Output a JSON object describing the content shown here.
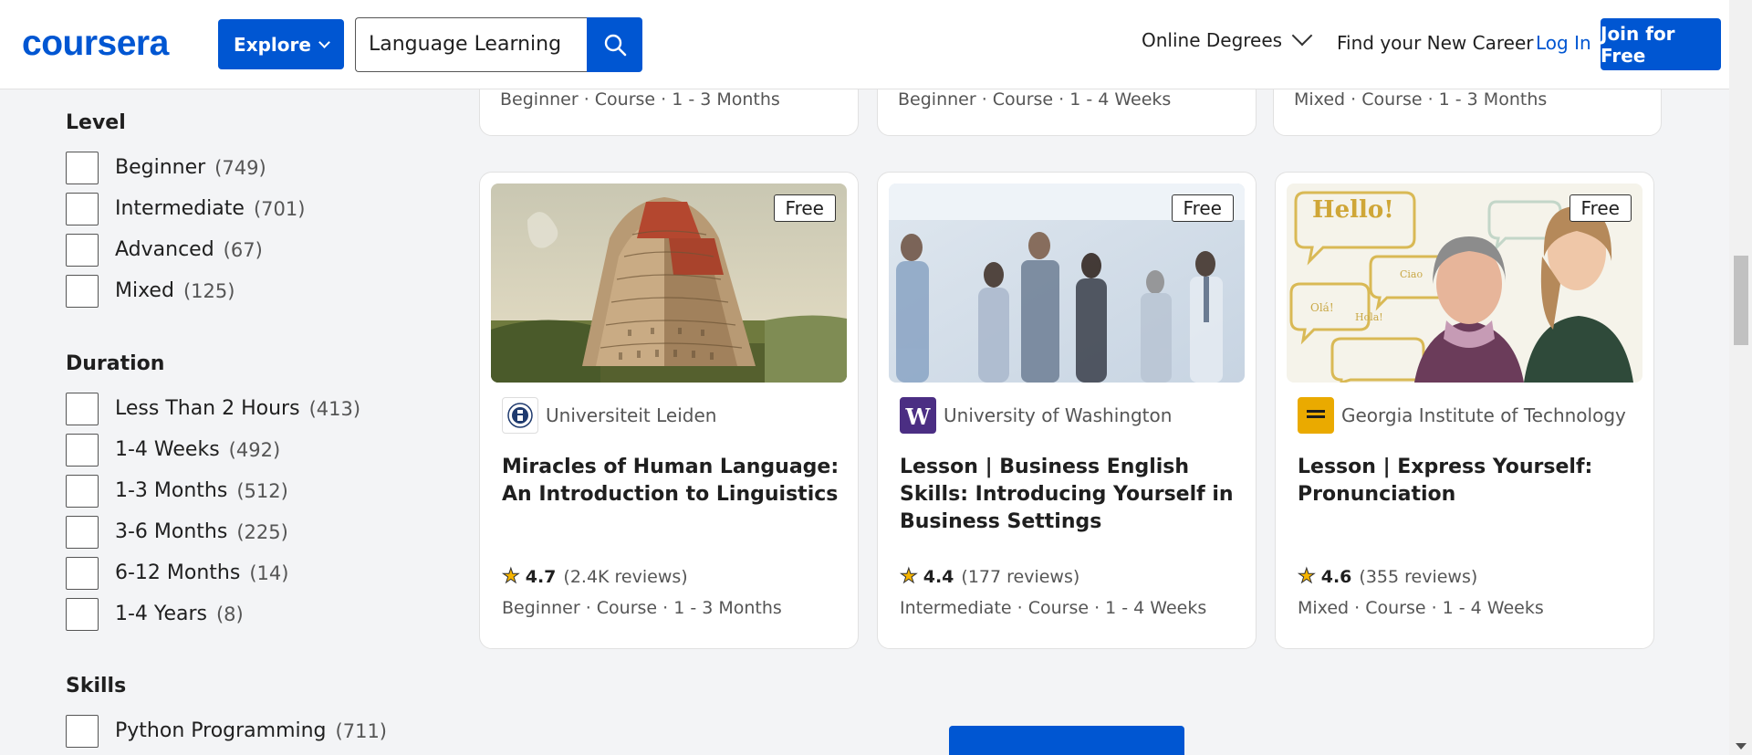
{
  "header": {
    "logo": "coursera",
    "explore_label": "Explore",
    "search_value": "Language Learning",
    "nav_online_degrees": "Online Degrees",
    "nav_find_career": "Find your New Career",
    "login_label": "Log In",
    "join_label": "Join for Free"
  },
  "filters": {
    "level": {
      "title": "Level",
      "items": [
        {
          "label": "Beginner",
          "count": "(749)"
        },
        {
          "label": "Intermediate",
          "count": "(701)"
        },
        {
          "label": "Advanced",
          "count": "(67)"
        },
        {
          "label": "Mixed",
          "count": "(125)"
        }
      ]
    },
    "duration": {
      "title": "Duration",
      "items": [
        {
          "label": "Less Than 2 Hours",
          "count": "(413)"
        },
        {
          "label": "1-4 Weeks",
          "count": "(492)"
        },
        {
          "label": "1-3 Months",
          "count": "(512)"
        },
        {
          "label": "3-6 Months",
          "count": "(225)"
        },
        {
          "label": "6-12 Months",
          "count": "(14)"
        },
        {
          "label": "1-4 Years",
          "count": "(8)"
        }
      ]
    },
    "skills": {
      "title": "Skills",
      "items": [
        {
          "label": "Python Programming",
          "count": "(711)"
        }
      ]
    }
  },
  "top_cards": [
    {
      "meta": "Beginner · Course · 1 - 3 Months"
    },
    {
      "meta": "Beginner · Course · 1 - 4 Weeks"
    },
    {
      "meta": "Mixed · Course · 1 - 3 Months"
    }
  ],
  "cards": [
    {
      "badge": "Free",
      "partner": "Universiteit Leiden",
      "partner_icon": "leiden-seal-icon",
      "title": "Miracles of Human Language: An Introduction to Linguistics",
      "rating": "4.7",
      "reviews": "(2.4K reviews)",
      "meta": "Beginner · Course · 1 - 3 Months"
    },
    {
      "badge": "Free",
      "partner": "University of Washington",
      "partner_icon": "uw-logo-icon",
      "title": "Lesson | Business English Skills: Introducing Yourself in Business Settings",
      "rating": "4.4",
      "reviews": "(177 reviews)",
      "meta": "Intermediate · Course · 1 - 4 Weeks"
    },
    {
      "badge": "Free",
      "partner": "Georgia Institute of Technology",
      "partner_icon": "georgia-tech-logo-icon",
      "title": "Lesson | Express Yourself: Pronunciation",
      "rating": "4.6",
      "reviews": "(355 reviews)",
      "meta": "Mixed · Course · 1 - 4 Weeks"
    }
  ],
  "image_text": {
    "hello": "Hello!",
    "ciao": "Ciao",
    "ola": "Olá!",
    "hola": "Hola!"
  },
  "colors": {
    "brand": "#0056d2",
    "uw_purple": "#4b2e83",
    "gt_gold": "#eaaa00"
  }
}
